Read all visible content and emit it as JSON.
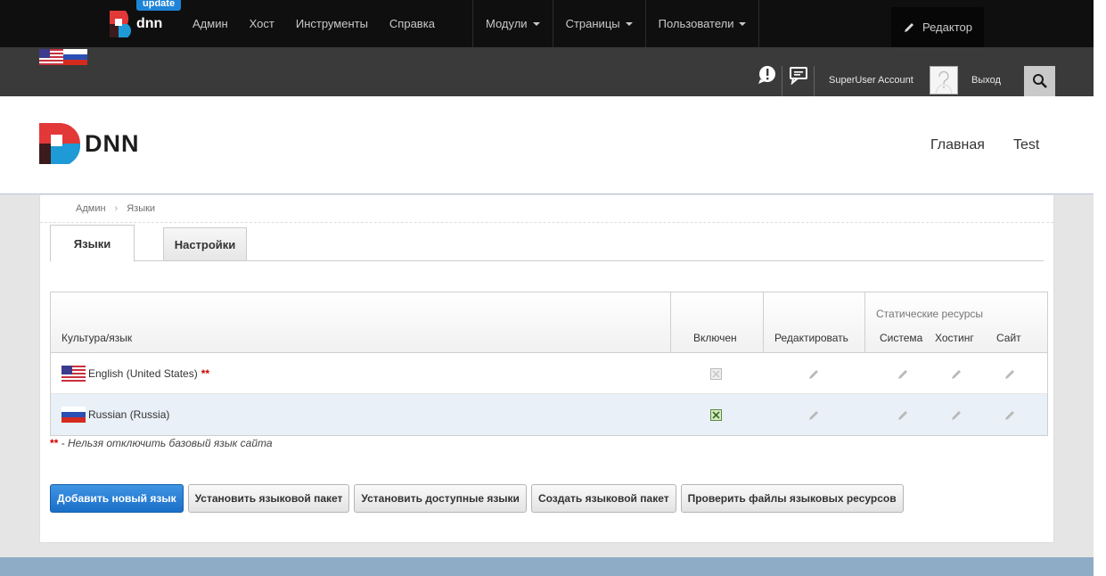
{
  "admin_bar": {
    "update_badge": "update",
    "logo_text": "dnn",
    "menu": [
      "Админ",
      "Хост",
      "Инструменты",
      "Справка"
    ],
    "dropdowns": [
      "Модули",
      "Страницы",
      "Пользователи"
    ],
    "editor_label": "Редактор"
  },
  "user_bar": {
    "account": "SuperUser Account",
    "logout": "Выход"
  },
  "site_header": {
    "logo_text": "DNN",
    "nav": [
      "Главная",
      "Test"
    ]
  },
  "breadcrumb": [
    "Админ",
    "Языки"
  ],
  "tabs": [
    "Языки",
    "Настройки"
  ],
  "table": {
    "headers": {
      "culture": "Культура/язык",
      "enabled": "Включен",
      "edit": "Редактировать",
      "static_resources": "Статические ресурсы",
      "system": "Система",
      "host": "Хостинг",
      "site": "Сайт"
    },
    "rows": [
      {
        "name": "English (United States)",
        "required_mark": "**",
        "enabled": false
      },
      {
        "name": "Russian (Russia)",
        "required_mark": "",
        "enabled": true
      }
    ]
  },
  "note": {
    "mark": "**",
    "text": " - Нельзя отключить базовый язык сайта"
  },
  "buttons": [
    "Добавить новый язык",
    "Установить языковой пакет",
    "Установить доступные языки",
    "Создать языковой пакет",
    "Проверить файлы языковых ресурсов"
  ],
  "colors": {
    "primary_button": "#1a6fc7",
    "dnn_red": "#e23838",
    "dnn_blue": "#1e9ad6"
  }
}
